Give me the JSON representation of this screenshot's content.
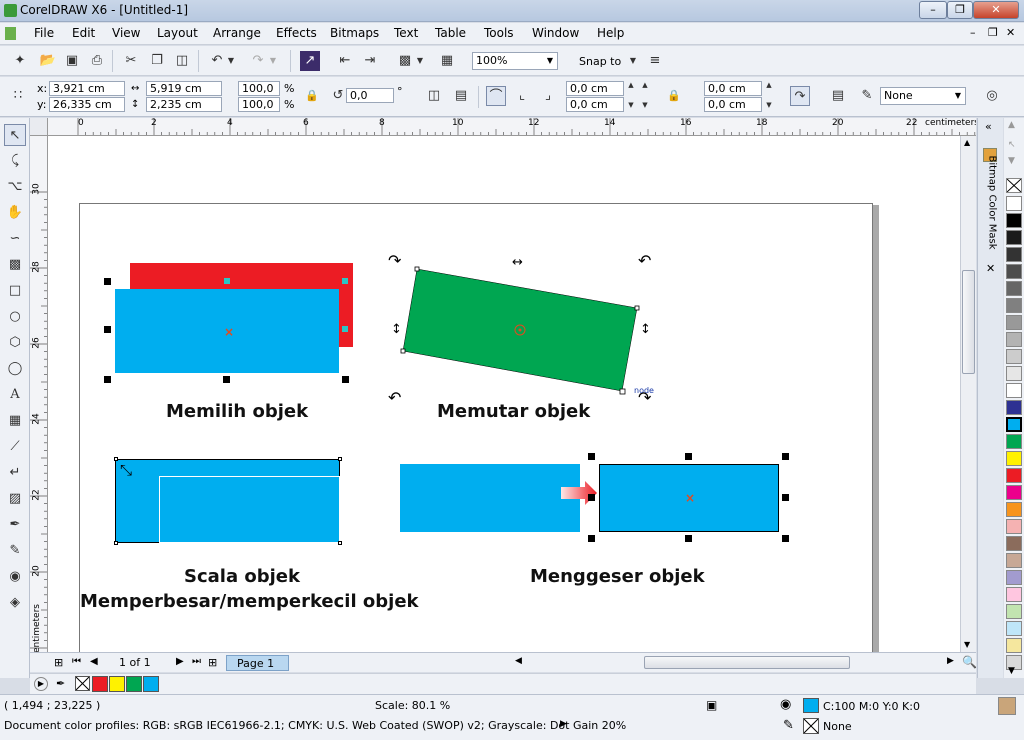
{
  "window": {
    "title": "CorelDRAW X6 - [Untitled-1]"
  },
  "menu": [
    "File",
    "Edit",
    "View",
    "Layout",
    "Arrange",
    "Effects",
    "Bitmaps",
    "Text",
    "Table",
    "Tools",
    "Window",
    "Help"
  ],
  "toolbar": {
    "zoom": "100%",
    "snap": "Snap to"
  },
  "props": {
    "x": "3,921 cm",
    "y": "26,335 cm",
    "width": "5,919 cm",
    "height": "2,235 cm",
    "scale_x": "100,0",
    "scale_y": "100,0",
    "pct": "%",
    "rotation": "0,0",
    "deg": "°",
    "pos_a": "0,0 cm",
    "pos_b": "0,0 cm",
    "pos_c": "0,0 cm",
    "pos_d": "0,0 cm",
    "outline": "None"
  },
  "ruler": {
    "units": "centimeters",
    "h_ticks": [
      "0",
      "2",
      "4",
      "6",
      "8",
      "10",
      "12",
      "14",
      "16",
      "18",
      "20",
      "22"
    ],
    "v_ticks": [
      "30",
      "28",
      "26",
      "24",
      "22",
      "20"
    ],
    "v_units": "centimeters"
  },
  "canvas": {
    "captions": {
      "select": "Memilih objek",
      "rotate": "Memutar objek",
      "scale1": "Scala objek",
      "scale2": "Memperbesar/memperkecil objek",
      "move": "Menggeser objek",
      "node": "node"
    },
    "colors": {
      "red": "#ec1c24",
      "blue": "#00aeef",
      "green": "#00a651"
    }
  },
  "pages": {
    "counter": "1 of 1",
    "tab": "Page 1"
  },
  "docker": {
    "title": "Bitmap Color Mask"
  },
  "palette": [
    "#ffffff",
    "#000000",
    "#1a1a1a",
    "#333333",
    "#4d4d4d",
    "#666666",
    "#808080",
    "#999999",
    "#b3b3b3",
    "#cccccc",
    "#e6e6e6",
    "#ffffff",
    "#2e3192",
    "#00aeef",
    "#00a651",
    "#fff200",
    "#ec1c24",
    "#ec008c",
    "#f7941d",
    "#f5b2b2",
    "#8b6c5c",
    "#c7a896",
    "#a29bcf",
    "#ffc6e0",
    "#c2e4b0",
    "#bfe6f9",
    "#f5e79e",
    "#d9d9d9"
  ],
  "doc_palette": [
    "#ec1c24",
    "#fff200",
    "#00a651",
    "#00aeef"
  ],
  "status": {
    "coords": "( 1,494 ; 23,225 )",
    "scale": "Scale: 80.1 %",
    "fill": "C:100 M:0 Y:0 K:0",
    "outline": "None",
    "profiles": "Document color profiles: RGB: sRGB IEC61966-2.1; CMYK: U.S. Web Coated (SWOP) v2; Grayscale: Dot Gain 20%"
  }
}
